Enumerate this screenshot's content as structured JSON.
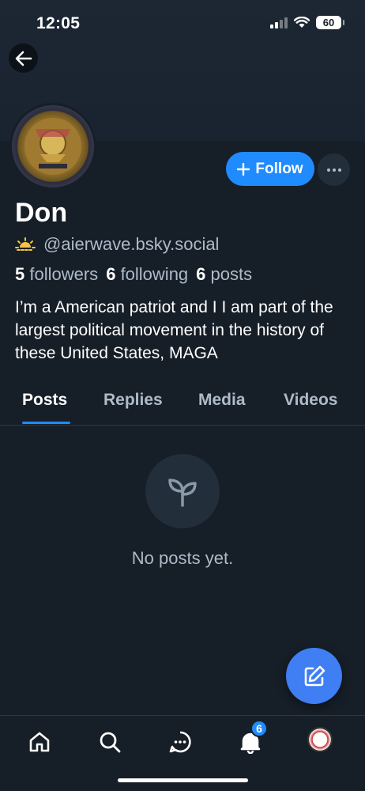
{
  "status_bar": {
    "time": "12:05",
    "battery": "60"
  },
  "profile": {
    "display_name": "Don",
    "handle": "@aierwave.bsky.social",
    "followers_count": "5",
    "followers_label": "followers",
    "following_count": "6",
    "following_label": "following",
    "posts_count": "6",
    "posts_label": "posts",
    "bio": "I’m a American patriot and I I am part of the largest political movement in the history of these United States, MAGA"
  },
  "actions": {
    "follow_label": "Follow"
  },
  "tabs": [
    {
      "label": "Posts",
      "active": true
    },
    {
      "label": "Replies",
      "active": false
    },
    {
      "label": "Media",
      "active": false
    },
    {
      "label": "Videos",
      "active": false
    }
  ],
  "empty_state": {
    "message": "No posts yet.",
    "icon": "seedling-icon"
  },
  "bottom_nav": {
    "items": [
      "home-icon",
      "search-icon",
      "chat-icon",
      "bell-icon",
      "avatar"
    ],
    "notifications_badge": "6"
  },
  "colors": {
    "accent": "#208bfe",
    "background": "#161e27",
    "muted_text": "#aebbc9",
    "fab": "#3f7ef3"
  }
}
